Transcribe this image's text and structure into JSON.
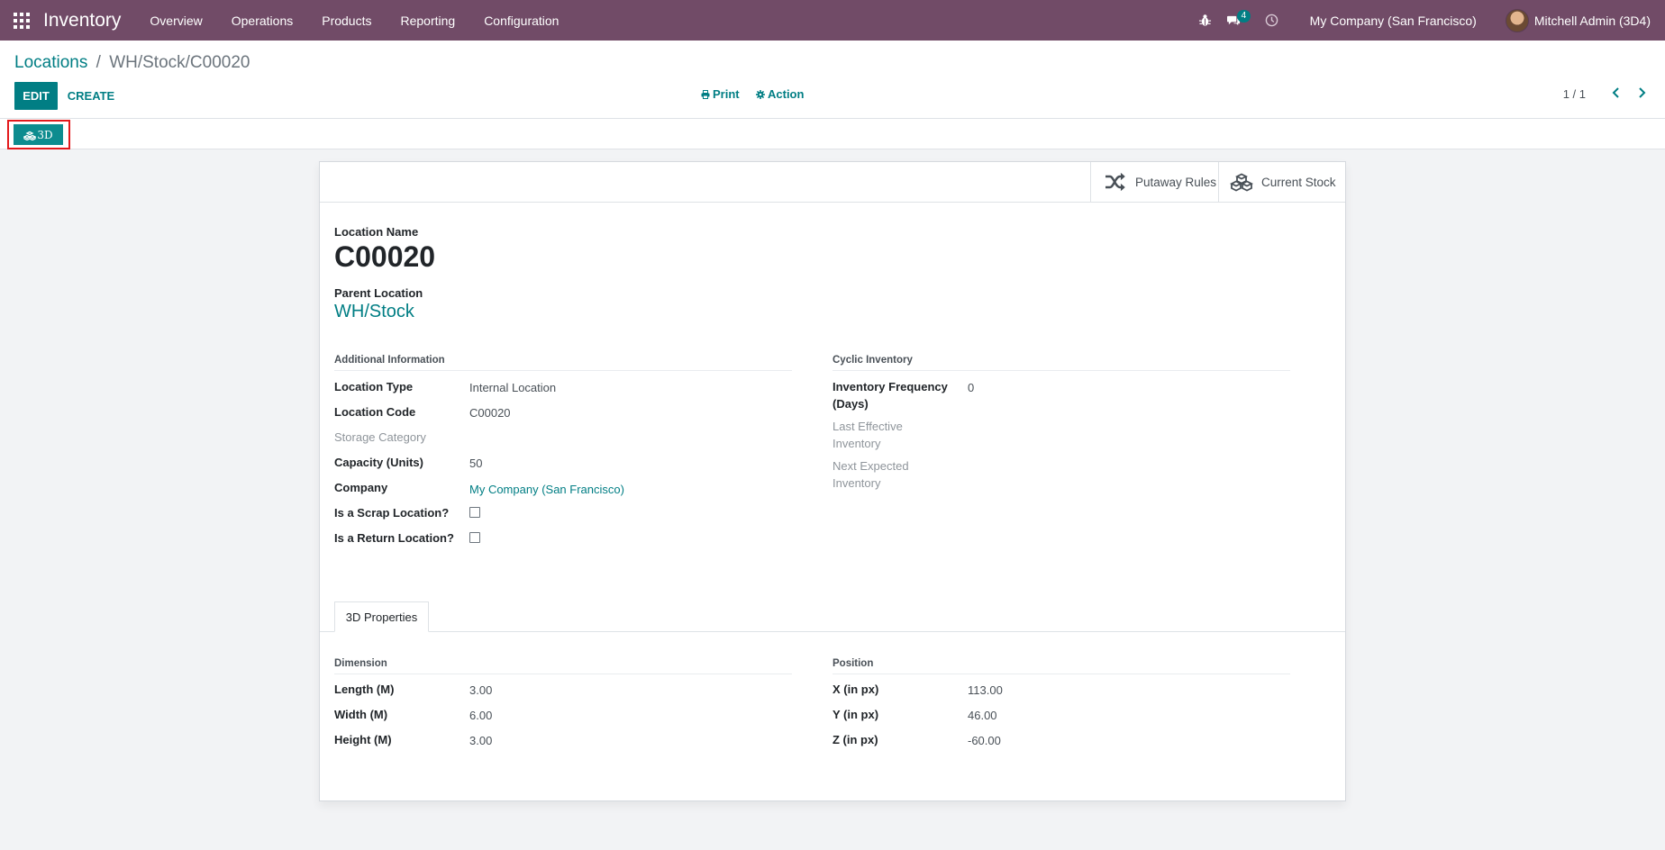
{
  "navbar": {
    "app_name": "Inventory",
    "menu": [
      "Overview",
      "Operations",
      "Products",
      "Reporting",
      "Configuration"
    ],
    "message_count": "4",
    "company": "My Company (San Francisco)",
    "user": "Mitchell Admin (3D4)",
    "bg_color": "#714B67"
  },
  "breadcrumb": {
    "parent": "Locations",
    "separator": "/",
    "current": "WH/Stock/C00020"
  },
  "toolbar": {
    "edit_label": "EDIT",
    "create_label": "CREATE",
    "print_label": "Print",
    "action_label": "Action",
    "pager": "1 / 1",
    "btn_3d_label": "3D"
  },
  "stat_buttons": {
    "putaway": "Putaway Rules",
    "stock": "Current Stock"
  },
  "form": {
    "location_name_label": "Location Name",
    "location_name": "C00020",
    "parent_location_label": "Parent Location",
    "parent_location": "WH/Stock",
    "additional_info": {
      "title": "Additional Information",
      "location_type_label": "Location Type",
      "location_type": "Internal Location",
      "location_code_label": "Location Code",
      "location_code": "C00020",
      "storage_category_label": "Storage Category",
      "capacity_label": "Capacity (Units)",
      "capacity": "50",
      "company_label": "Company",
      "company": "My Company (San Francisco)",
      "scrap_label": "Is a Scrap Location?",
      "return_label": "Is a Return Location?"
    },
    "cyclic_inventory": {
      "title": "Cyclic Inventory",
      "frequency_label_1": "Inventory Frequency",
      "frequency_label_2": "(Days)",
      "frequency": "0",
      "last_label_1": "Last Effective",
      "last_label_2": "Inventory",
      "next_label_1": "Next Expected",
      "next_label_2": "Inventory"
    },
    "tab_label": "3D Properties",
    "dimension": {
      "title": "Dimension",
      "length_label": "Length (M)",
      "length": "3.00",
      "width_label": "Width (M)",
      "width": "6.00",
      "height_label": "Height (M)",
      "height": "3.00"
    },
    "position": {
      "title": "Position",
      "x_label": "X (in px)",
      "x": "113.00",
      "y_label": "Y (in px)",
      "y": "46.00",
      "z_label": "Z (in px)",
      "z": "-60.00"
    }
  }
}
